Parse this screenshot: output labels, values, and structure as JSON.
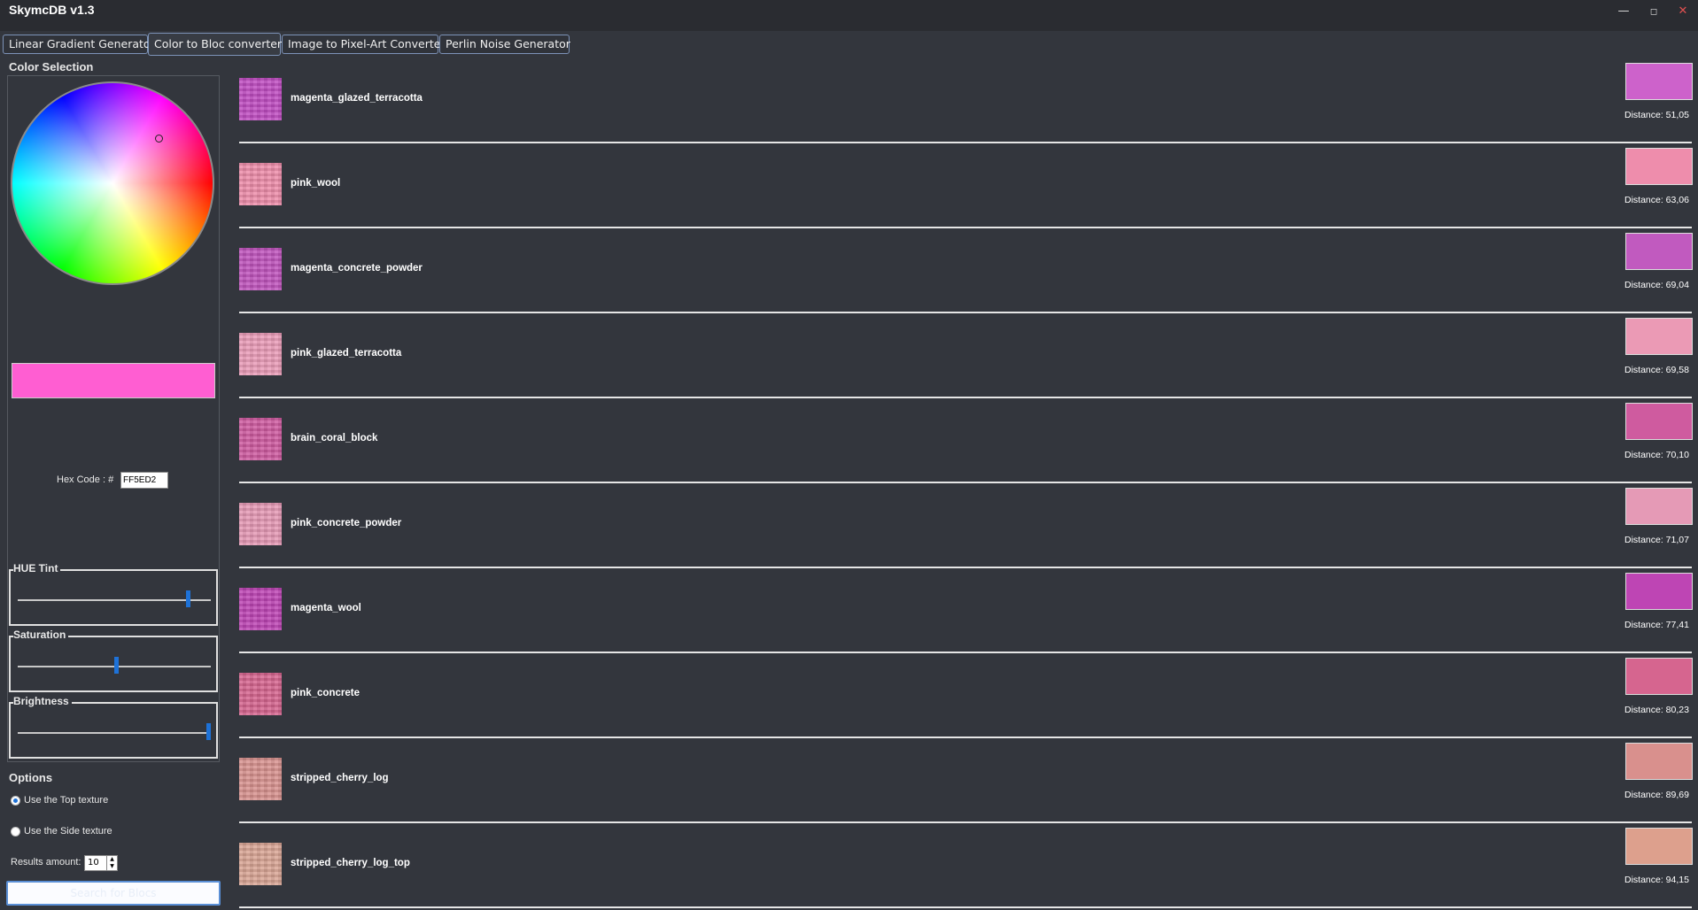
{
  "window": {
    "title": "SkymcDB v1.3",
    "min_glyph": "—",
    "max_glyph": "◻",
    "close_glyph": "✕"
  },
  "tabs": [
    {
      "label": "Linear Gradient Generator"
    },
    {
      "label": "Color to Bloc converter"
    },
    {
      "label": "Image to Pixel-Art Converter"
    },
    {
      "label": "Perlin Noise Generator"
    }
  ],
  "color_selection": {
    "title": "Color Selection",
    "preview_color": "#FF5ED2",
    "hex_label": "Hex Code : #",
    "hex_value": "FF5ED2"
  },
  "sliders": [
    {
      "label": "HUE Tint",
      "level": 0.89
    },
    {
      "label": "Saturation",
      "level": 0.51
    },
    {
      "label": "Brightness",
      "level": 1.0
    }
  ],
  "options": {
    "title": "Options",
    "top_texture_label": "Use the Top texture",
    "side_texture_label": "Use the Side texture",
    "selected": "top",
    "results_label": "Results amount:",
    "results_value": "10",
    "search_button_label": "Search for Blocs"
  },
  "results": [
    {
      "name": "magenta_glazed_terracotta",
      "color": "#CD62CB",
      "texture_color": "#c04dc2",
      "distance": "Distance: 51,05"
    },
    {
      "name": "pink_wool",
      "color": "#EE8DAC",
      "texture_color": "#ee8daa",
      "distance": "Distance: 63,06"
    },
    {
      "name": "magenta_concrete_powder",
      "color": "#C15ABF",
      "texture_color": "#c054bd",
      "distance": "Distance: 69,04"
    },
    {
      "name": "pink_glazed_terracotta",
      "color": "#EB9AB5",
      "texture_color": "#ea9cb8",
      "distance": "Distance: 69,58"
    },
    {
      "name": "brain_coral_block",
      "color": "#CF5B9F",
      "texture_color": "#cf5ba0",
      "distance": "Distance: 70,10"
    },
    {
      "name": "pink_concrete_powder",
      "color": "#E59AB6",
      "texture_color": "#e599b5",
      "distance": "Distance: 71,07"
    },
    {
      "name": "magenta_wool",
      "color": "#BE45B4",
      "texture_color": "#be45b5",
      "distance": "Distance: 77,41"
    },
    {
      "name": "pink_concrete",
      "color": "#D6658F",
      "texture_color": "#d6658f",
      "distance": "Distance: 80,23"
    },
    {
      "name": "stripped_cherry_log",
      "color": "#D9908D",
      "texture_color": "#d8928f",
      "distance": "Distance: 89,69"
    },
    {
      "name": "stripped_cherry_log_top",
      "color": "#DDA08D",
      "texture_color": "#d9a595",
      "distance": "Distance: 94,15"
    }
  ]
}
